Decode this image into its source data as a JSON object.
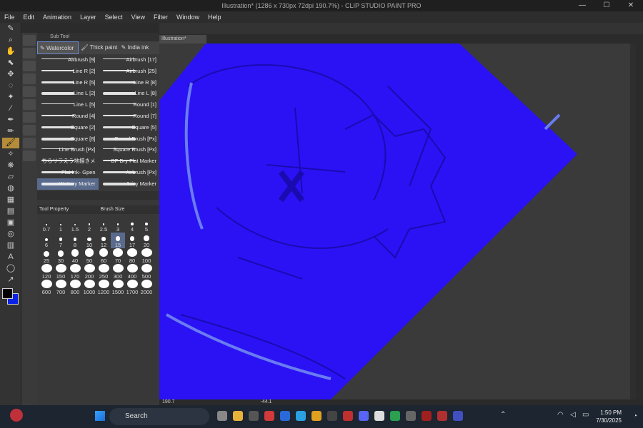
{
  "window": {
    "title": "Illustration* (1286 x 730px 72dpi 190.7%) - CLIP STUDIO PAINT PRO"
  },
  "menu": [
    "File",
    "Edit",
    "Animation",
    "Layer",
    "Select",
    "View",
    "Filter",
    "Window",
    "Help"
  ],
  "subtool_panel": {
    "header": "Sub Tool",
    "tabs": [
      "Watercolor",
      "Thick paint",
      "India ink"
    ],
    "brushes": [
      [
        "Airbrush [9]",
        "Airbrush [17]"
      ],
      [
        "Line R [2]",
        "Airbrush [25]"
      ],
      [
        "Line R [5]",
        "Line R [8]"
      ],
      [
        "Line L [2]",
        "Line L [8]"
      ],
      [
        "Line L [5]",
        "Round [1]"
      ],
      [
        "Round [4]",
        "Round [7]"
      ],
      [
        "Square [2]",
        "Square [5]"
      ],
      [
        "Square [8]",
        "Round Brush [Px]"
      ],
      [
        "Line Brush [Px]",
        "Square Brush [Px]"
      ],
      [
        "ちらリラえう地描きメ",
        "BF Dry Flat Marker"
      ],
      [
        "Flat Ink- Gpen",
        "Airbrush [Px]"
      ],
      [
        "Wattery Marker",
        "Juicy Marker"
      ]
    ]
  },
  "brush_size_panel": {
    "tabs": [
      "Tool Property",
      "Brush Size"
    ],
    "sizes": [
      "0.7",
      "1",
      "1.5",
      "2",
      "2.5",
      "3",
      "4",
      "5",
      "6",
      "7",
      "8",
      "10",
      "12",
      "15",
      "17",
      "20",
      "25",
      "30",
      "40",
      "50",
      "60",
      "70",
      "80",
      "100",
      "120",
      "150",
      "170",
      "200",
      "250",
      "300",
      "400",
      "500",
      "600",
      "700",
      "800",
      "1000",
      "1200",
      "1500",
      "1700",
      "2000"
    ],
    "selected": "15"
  },
  "document": {
    "tab": "Illustration*"
  },
  "statusbar": {
    "zoom": "190.7",
    "angle": "-44.1"
  },
  "taskbar": {
    "search_placeholder": "Search",
    "time": "1:50 PM",
    "date": "7/30/2025"
  },
  "colors": {
    "canvas_fill": "#2a12f5",
    "line_color": "#1a0bb0",
    "highlight": "#6a7cf0",
    "main_color": "#000000",
    "sub_color": "#0a22e6"
  }
}
